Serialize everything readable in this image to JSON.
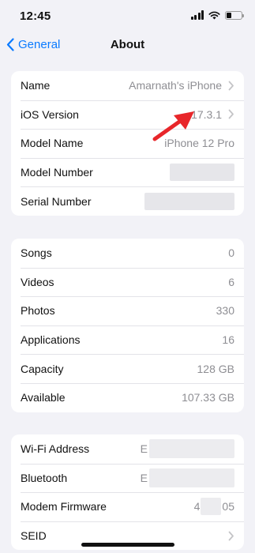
{
  "status_bar": {
    "time": "12:45",
    "battery_level": 0.35
  },
  "nav": {
    "back_label": "General",
    "title": "About"
  },
  "about_group": {
    "rows": [
      {
        "label": "Name",
        "value": "Amarnath's iPhone"
      },
      {
        "label": "iOS Version",
        "value": "17.3.1"
      },
      {
        "label": "Model Name",
        "value": "iPhone 12 Pro"
      },
      {
        "label": "Model Number",
        "value": ""
      },
      {
        "label": "Serial Number",
        "value": ""
      }
    ]
  },
  "stats_group": {
    "rows": [
      {
        "label": "Songs",
        "value": "0"
      },
      {
        "label": "Videos",
        "value": "6"
      },
      {
        "label": "Photos",
        "value": "330"
      },
      {
        "label": "Applications",
        "value": "16"
      },
      {
        "label": "Capacity",
        "value": "128 GB"
      },
      {
        "label": "Available",
        "value": "107.33 GB"
      }
    ]
  },
  "network_group": {
    "rows": [
      {
        "label": "Wi-Fi Address",
        "value_prefix": "E"
      },
      {
        "label": "Bluetooth",
        "value_prefix": "E"
      },
      {
        "label": "Modem Firmware",
        "value_prefix": "4",
        "value_suffix": "05"
      },
      {
        "label": "SEID"
      }
    ]
  },
  "colors": {
    "accent": "#0a7aff",
    "annotation_arrow": "#e8262a"
  }
}
